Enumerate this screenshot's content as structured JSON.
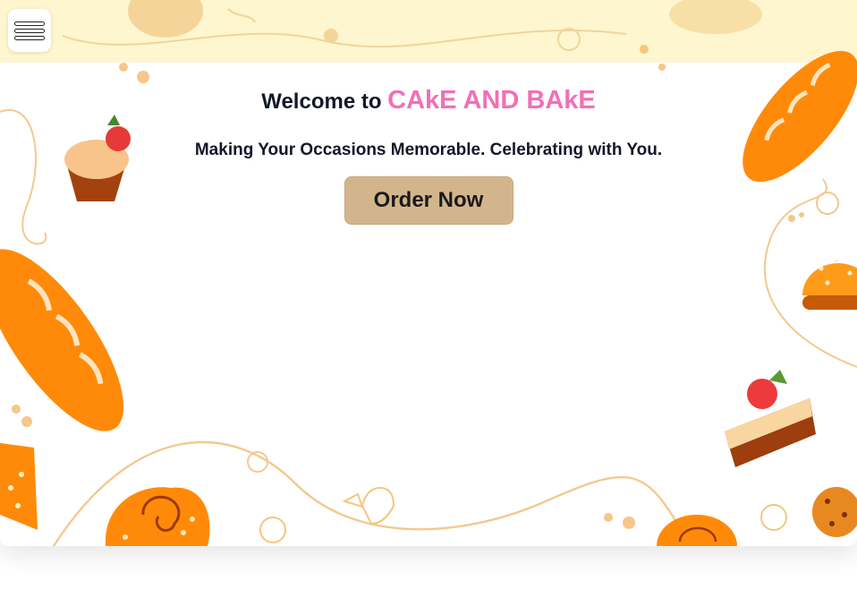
{
  "nav": {
    "menu_icon": "hamburger-menu-icon"
  },
  "hero": {
    "welcome_prefix": "Welcome to ",
    "brand_name": "CAkE AND BAkE",
    "tagline": "Making Your Occasions Memorable. Celebrating with You.",
    "cta_label": "Order Now"
  },
  "colors": {
    "brand_pink": "#f26fb6",
    "button_tan": "#d3b58d",
    "top_strip": "#fdf6cf",
    "pastry_orange": "#ff8a0a",
    "text_dark": "#111827"
  },
  "decorations": [
    "baguette",
    "cupcake",
    "cake-slice",
    "bun",
    "cookie",
    "croissant",
    "cinnamon-roll",
    "strawberry"
  ]
}
